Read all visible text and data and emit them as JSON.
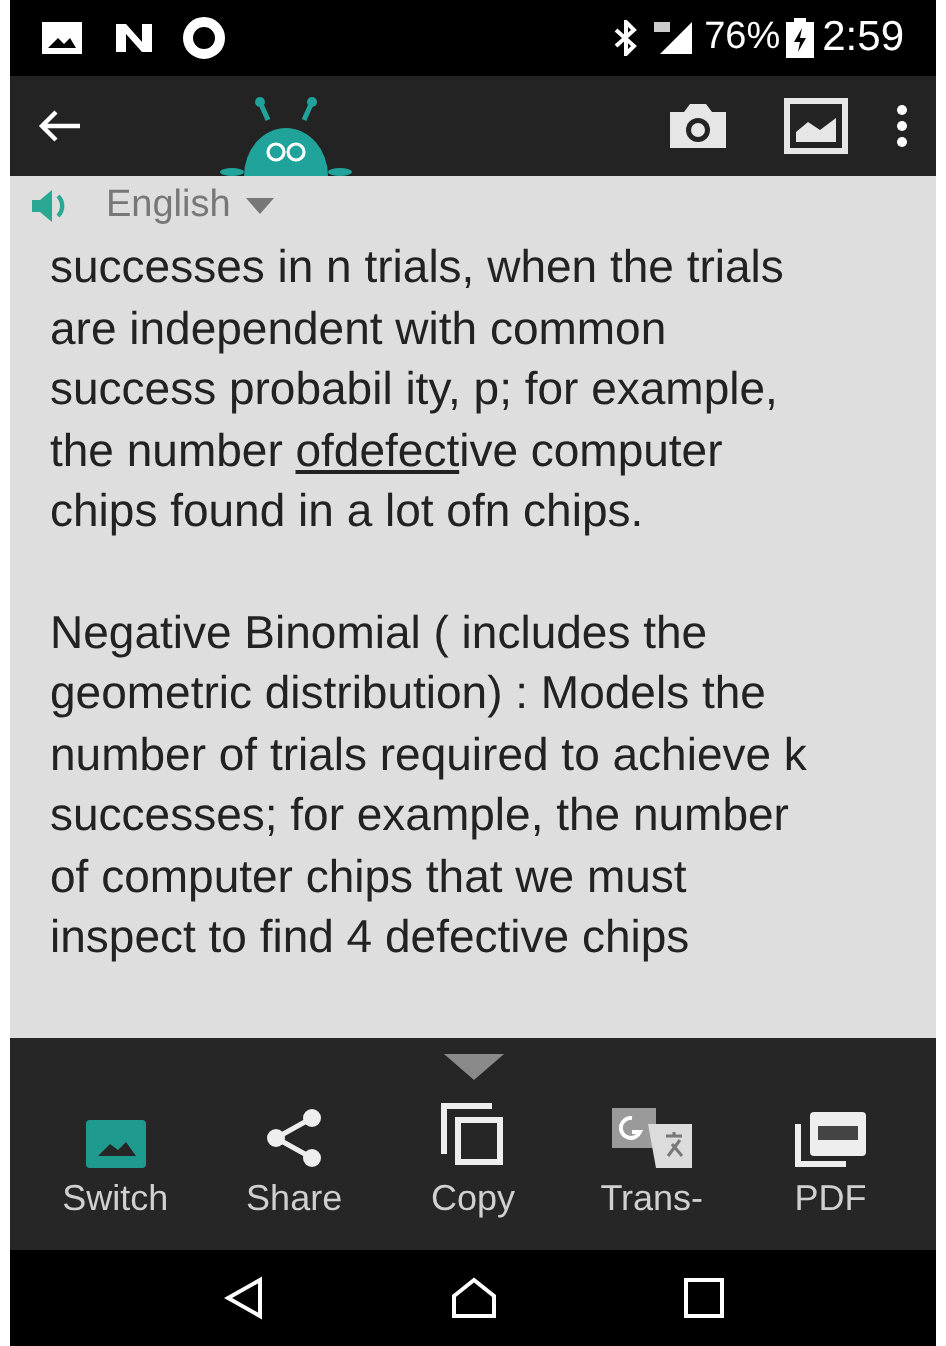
{
  "status_bar": {
    "battery": "76%",
    "time": "2:59"
  },
  "language": {
    "label": "English"
  },
  "paragraphs": [
    {
      "lines": [
        [
          {
            "text": "successes in n trials, when the trials",
            "underlined": false
          }
        ],
        [
          {
            "text": "are independent with common",
            "underlined": false
          }
        ],
        [
          {
            "text": "success probabil ity, p; for example,",
            "underlined": false
          }
        ],
        [
          {
            "text": "the number ",
            "underlined": false
          },
          {
            "text": "ofdefect",
            "underlined": true
          },
          {
            "text": "ive computer",
            "underlined": false
          }
        ],
        [
          {
            "text": "chips found in a lot ofn chips.",
            "underlined": false
          }
        ]
      ]
    },
    {
      "lines": [
        [
          {
            "text": "Negative Binomial ( includes the",
            "underlined": false
          }
        ],
        [
          {
            "text": "geometric distribution) : Models the",
            "underlined": false
          }
        ],
        [
          {
            "text": "number of trials required to achieve k",
            "underlined": false
          }
        ],
        [
          {
            "text": "successes; for example, the number",
            "underlined": false
          }
        ],
        [
          {
            "text": "of computer chips that we must",
            "underlined": false
          }
        ],
        [
          {
            "text": "inspect to find 4 defective chips",
            "underlined": false
          }
        ]
      ]
    }
  ],
  "actions": [
    {
      "kind": "switch",
      "label": "Switch"
    },
    {
      "kind": "share",
      "label": "Share"
    },
    {
      "kind": "copy",
      "label": "Copy"
    },
    {
      "kind": "translate",
      "label": "Trans-"
    },
    {
      "kind": "pdf",
      "label": "PDF"
    }
  ]
}
